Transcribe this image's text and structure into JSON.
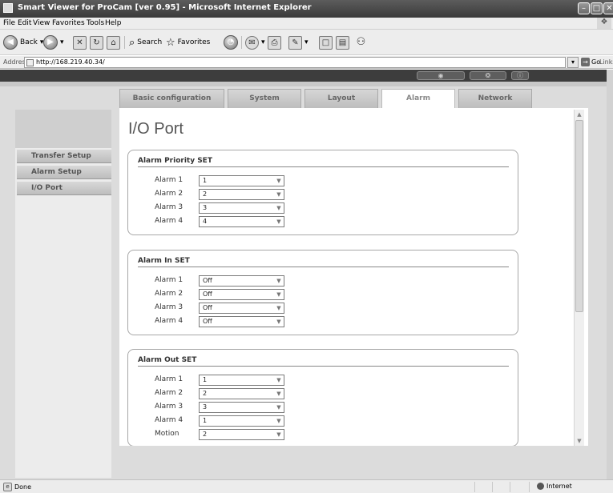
{
  "window": {
    "title": "Smart Viewer for ProCam [ver 0.95] - Microsoft Internet Explorer",
    "buttons": {
      "minimize": "–",
      "maximize": "□",
      "close": "✕"
    }
  },
  "menu": [
    "File",
    "Edit",
    "View",
    "Favorites",
    "Tools",
    "Help"
  ],
  "toolbar": {
    "back": "Back",
    "search": "Search",
    "favorites": "Favorites"
  },
  "address": {
    "label": "Address",
    "url": "http://168.219.40.34/",
    "go": "Go",
    "links": "Links"
  },
  "app": {
    "header_buttons": [
      "◉",
      "❂",
      "ⓘ"
    ],
    "tabs": [
      {
        "label": "Basic configuration",
        "active": false
      },
      {
        "label": "System",
        "active": false
      },
      {
        "label": "Layout",
        "active": false
      },
      {
        "label": "Alarm",
        "active": true
      },
      {
        "label": "Network",
        "active": false
      }
    ],
    "sidebar": [
      "Transfer Setup",
      "Alarm Setup",
      "I/O Port"
    ]
  },
  "page": {
    "title": "I/O Port",
    "sections": [
      {
        "heading": "Alarm Priority SET",
        "rows": [
          {
            "label": "Alarm 1",
            "value": "1"
          },
          {
            "label": "Alarm 2",
            "value": "2"
          },
          {
            "label": "Alarm 3",
            "value": "3"
          },
          {
            "label": "Alarm 4",
            "value": "4"
          }
        ]
      },
      {
        "heading": "Alarm In SET",
        "rows": [
          {
            "label": "Alarm 1",
            "value": "Off"
          },
          {
            "label": "Alarm 2",
            "value": "Off"
          },
          {
            "label": "Alarm 3",
            "value": "Off"
          },
          {
            "label": "Alarm 4",
            "value": "Off"
          }
        ]
      },
      {
        "heading": "Alarm Out SET",
        "rows": [
          {
            "label": "Alarm 1",
            "value": "1"
          },
          {
            "label": "Alarm 2",
            "value": "2"
          },
          {
            "label": "Alarm 3",
            "value": "3"
          },
          {
            "label": "Alarm 4",
            "value": "1"
          },
          {
            "label": "Motion",
            "value": "2"
          }
        ]
      }
    ]
  },
  "status": {
    "left": "Done",
    "zone": "Internet"
  }
}
